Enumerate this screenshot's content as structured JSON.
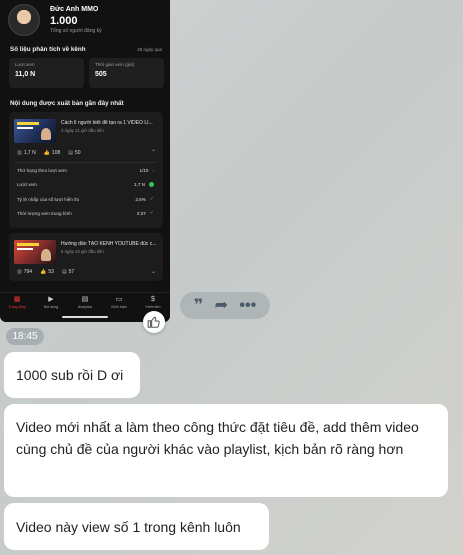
{
  "phone": {
    "channel_name": "Đức Anh MMO",
    "subscribers": "1.000",
    "subscribers_label": "Tổng số người đăng ký",
    "analytics_title": "Số liệu phân tích về kênh",
    "analytics_period": "28 ngày qua",
    "views_label": "Lượt xem",
    "views_value": "11,0 N",
    "watchtime_label": "Thời gian xem (giờ)",
    "watchtime_value": "505",
    "recent_title": "Nội dung được xuất bản gần đây nhất",
    "video1": {
      "title": "Cách lì người biết để tạo ra 1 VIDEO LI...",
      "date": "3 ngày 21 giờ đầu tiên",
      "views": "1,7 N",
      "likes": "108",
      "comments": "50"
    },
    "metrics": [
      {
        "label": "Thứ hạng theo lượt xem",
        "value": "1/10",
        "marker": "›"
      },
      {
        "label": "Lượt xem",
        "value": "1,7 N",
        "marker": "dot"
      },
      {
        "label": "Tỷ lệ nhấp của số lượt hiển thị",
        "value": "2,6%",
        "marker": "✓"
      },
      {
        "label": "Thời lượng xem trung bình",
        "value": "2:37",
        "marker": "✓"
      }
    ],
    "video2": {
      "title": "Hướng dẫn TẠO KÊNH YOUTUBE đúc c...",
      "date": "6 ngày 22 giờ đầu tiên",
      "views": "794",
      "likes": "53",
      "comments": "57"
    },
    "nav": [
      {
        "label": "Trang tổng",
        "icon": "dashboard-icon"
      },
      {
        "label": "Nội dung",
        "icon": "content-icon"
      },
      {
        "label": "Analytics",
        "icon": "analytics-icon"
      },
      {
        "label": "Bình luận",
        "icon": "comments-icon"
      },
      {
        "label": "Kiếm tiền",
        "icon": "monetization-icon"
      }
    ]
  },
  "actions": {
    "quote_icon": "quote-icon",
    "forward_icon": "forward-icon",
    "more_icon": "more-icon"
  },
  "chat": {
    "time": "18:45",
    "messages": [
      "1000 sub rồi D ơi",
      "Video mới nhất a làm theo công thức đặt tiêu đề, add thêm video cùng chủ đề của người khác vào playlist, kịch bản rõ ràng hơn",
      "Video này view số 1 trong kênh luôn"
    ]
  },
  "colors": {
    "accent_red": "#e53935",
    "good_green": "#34c759"
  }
}
